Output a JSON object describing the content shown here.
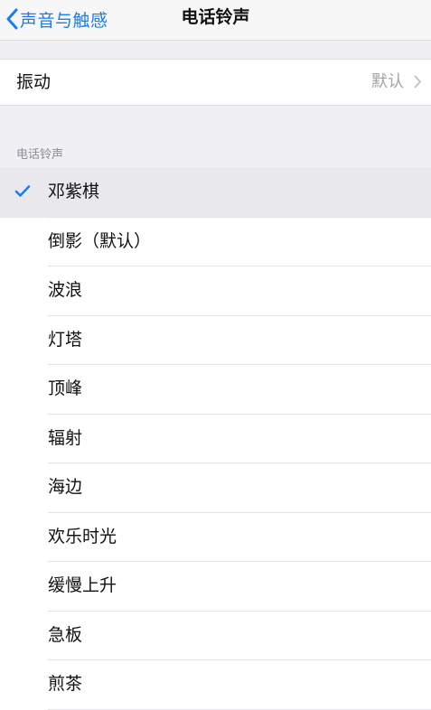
{
  "nav": {
    "back_label": "声音与触感",
    "title": "电话铃声"
  },
  "vibration": {
    "label": "振动",
    "value": "默认"
  },
  "ringtones": {
    "header": "电话铃声",
    "items": [
      {
        "label": "邓紫棋",
        "selected": true
      },
      {
        "label": "倒影（默认）",
        "selected": false
      },
      {
        "label": "波浪",
        "selected": false
      },
      {
        "label": "灯塔",
        "selected": false
      },
      {
        "label": "顶峰",
        "selected": false
      },
      {
        "label": "辐射",
        "selected": false
      },
      {
        "label": "海边",
        "selected": false
      },
      {
        "label": "欢乐时光",
        "selected": false
      },
      {
        "label": "缓慢上升",
        "selected": false
      },
      {
        "label": "急板",
        "selected": false
      },
      {
        "label": "煎茶",
        "selected": false
      }
    ]
  },
  "colors": {
    "accent": "#1a7cf5",
    "grouped_background": "#efeff4",
    "selected_row": "#e9e9ed",
    "secondary_text": "#a3a3a8"
  },
  "icons": {
    "back": "chevron-left-icon",
    "disclosure": "chevron-right-icon",
    "selected": "checkmark-icon"
  }
}
